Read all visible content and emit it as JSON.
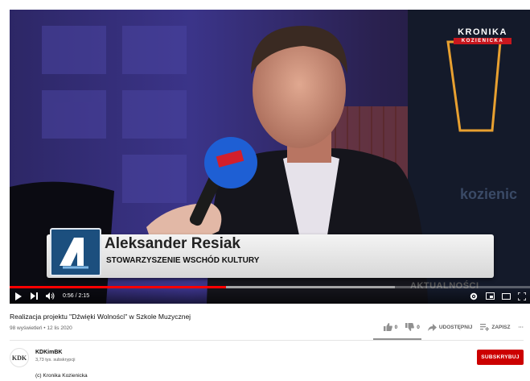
{
  "player": {
    "lower_third": {
      "name": "Aleksander Resiak",
      "subtitle": "STOWARZYSZENIE WSCHÓD KULTURY",
      "tag": "AKTUALNOŚCI"
    },
    "station_logo": {
      "line1": "KRONIKA",
      "line2": "KOZIENICKA"
    },
    "time": "0:56 / 2:15",
    "progress_played": 0.415,
    "progress_loaded": 0.74,
    "icons": [
      "play-icon",
      "next-icon",
      "volume-icon",
      "settings-icon",
      "miniplayer-icon",
      "theater-icon",
      "fullscreen-icon"
    ]
  },
  "video": {
    "title": "Realizacja projektu \"Dźwięki Wolności\" w Szkole Muzycznej",
    "stats": "98 wyświetleń • 12 lis 2020"
  },
  "actions": {
    "likes": "0",
    "dislikes": "0",
    "share_label": "UDOSTĘPNIJ",
    "save_label": "ZAPISZ",
    "more_label": "···"
  },
  "channel": {
    "avatar_text": "KDK",
    "name": "KDKimBK",
    "subscribers": "3,73 tys. subskrypcji",
    "subscribe_label": "SUBSKRYBUJ",
    "description": "(c) Kronika Kozienicka"
  },
  "colors": {
    "accent": "#ff0000",
    "subscribe": "#cc0000",
    "lower_third_logo": "#1c4f7e",
    "mic": "#1e5fd4"
  }
}
